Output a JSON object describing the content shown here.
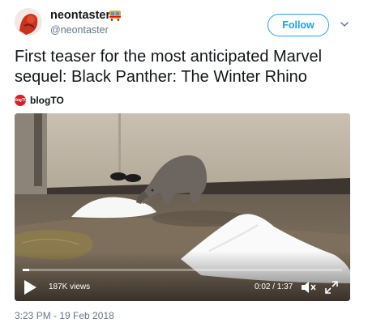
{
  "author": {
    "display_name": "neontaster",
    "handle": "@neontaster",
    "name_emoji": "tram-icon",
    "avatar_icon": "avatar-icon"
  },
  "follow_label": "Follow",
  "tweet": {
    "text": "First teaser for the most anticipated Marvel sequel: Black Panther: The Winter Rhino"
  },
  "source": {
    "name": "blogTO",
    "logo_text": "blogTO"
  },
  "video": {
    "views": "187K views",
    "timecode": "0:02 / 1:37",
    "progress_fraction": 0.02
  },
  "timestamp": "3:23 PM - 19 Feb 2018",
  "colors": {
    "accent": "#1da1f2",
    "text": "#14171a",
    "muted": "#657786",
    "blogto_red": "#d61f26"
  }
}
